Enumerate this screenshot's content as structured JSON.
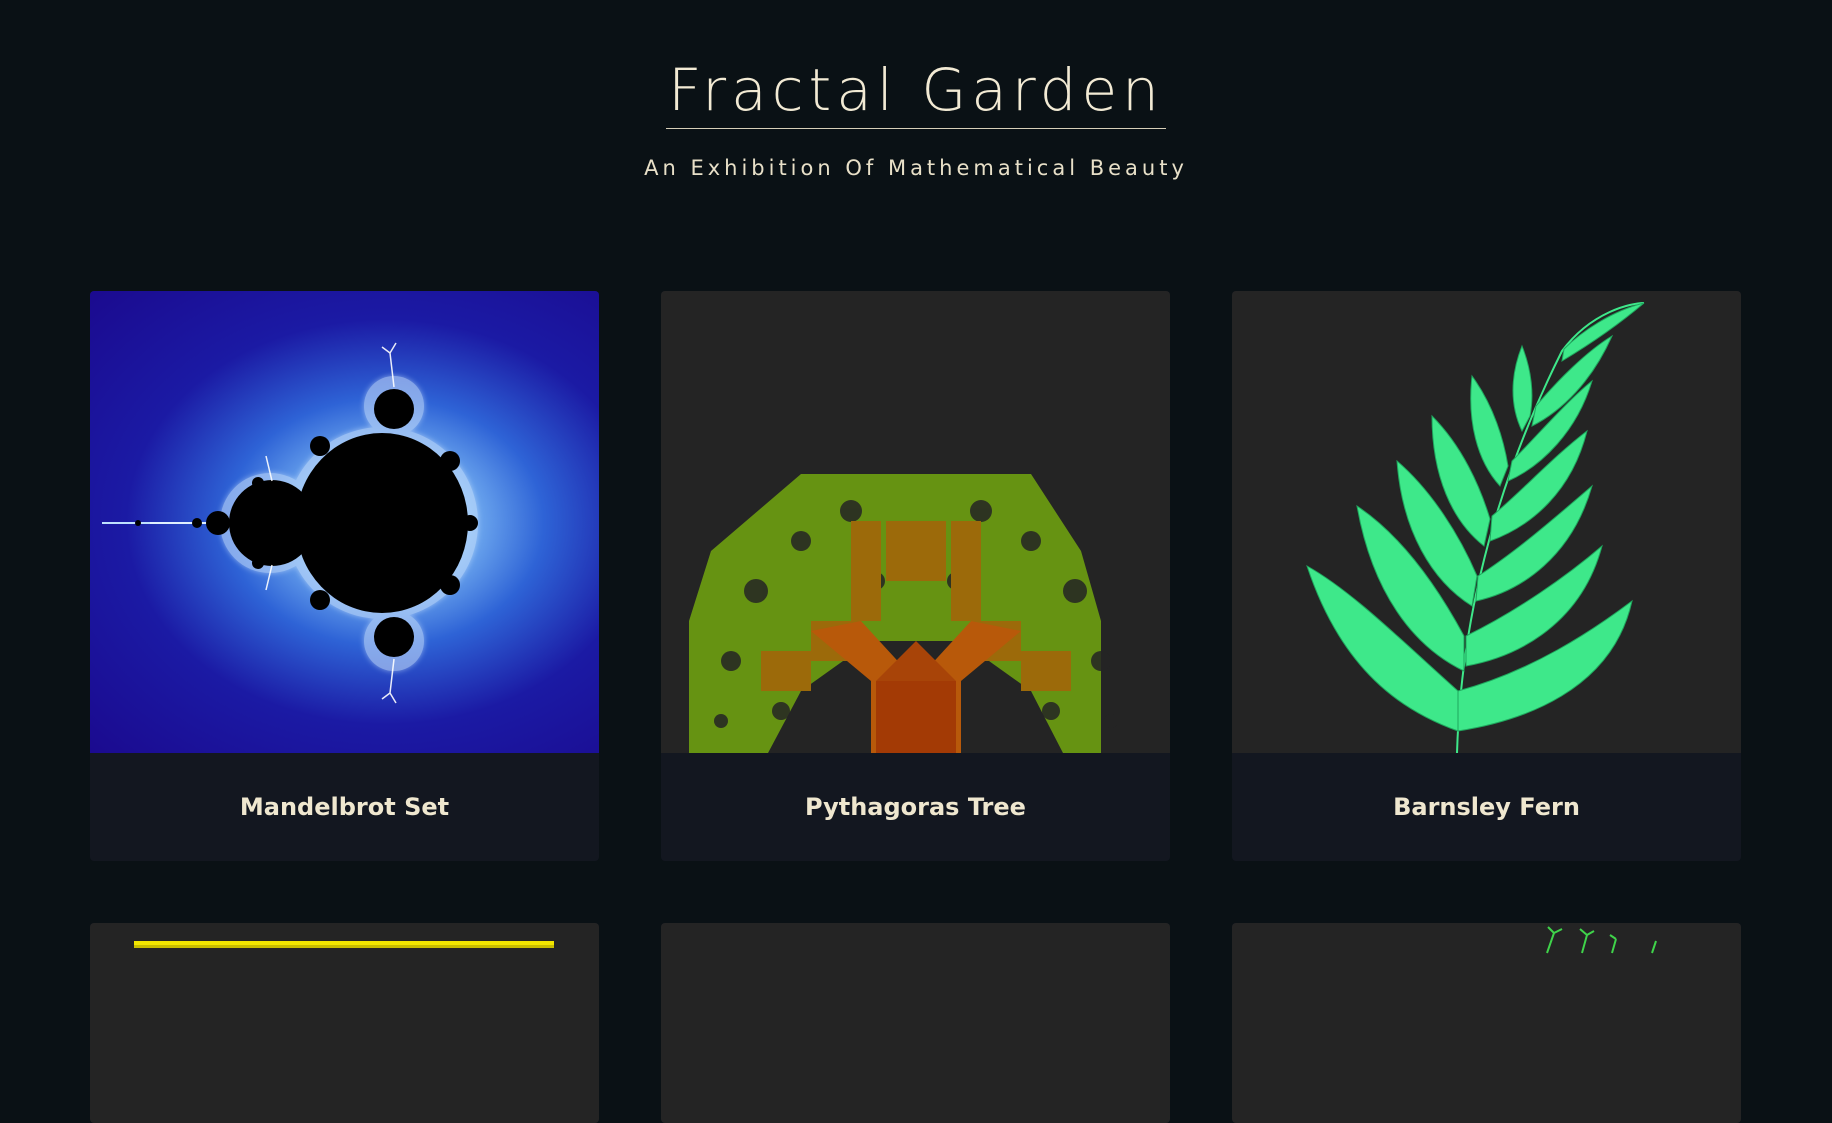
{
  "header": {
    "title": "Fractal Garden",
    "subtitle": "An Exhibition Of Mathematical Beauty"
  },
  "gallery": {
    "cards": [
      {
        "label": "Mandelbrot Set",
        "icon": "mandelbrot-image"
      },
      {
        "label": "Pythagoras Tree",
        "icon": "pythagoras-tree-image"
      },
      {
        "label": "Barnsley Fern",
        "icon": "barnsley-fern-image"
      },
      {
        "label": "",
        "icon": "fractal-image"
      },
      {
        "label": "",
        "icon": "fractal-image"
      },
      {
        "label": "",
        "icon": "fractal-image"
      }
    ]
  },
  "colors": {
    "background": "#0a1115",
    "card_art_background": "#242424",
    "caption_background": "#131720",
    "text": "#f2ead4",
    "mandelbrot_blue": "#1b0a8f",
    "fern_green": "#3ee88a",
    "tree_orange": "#a33a05",
    "tree_green": "#6aa510"
  }
}
